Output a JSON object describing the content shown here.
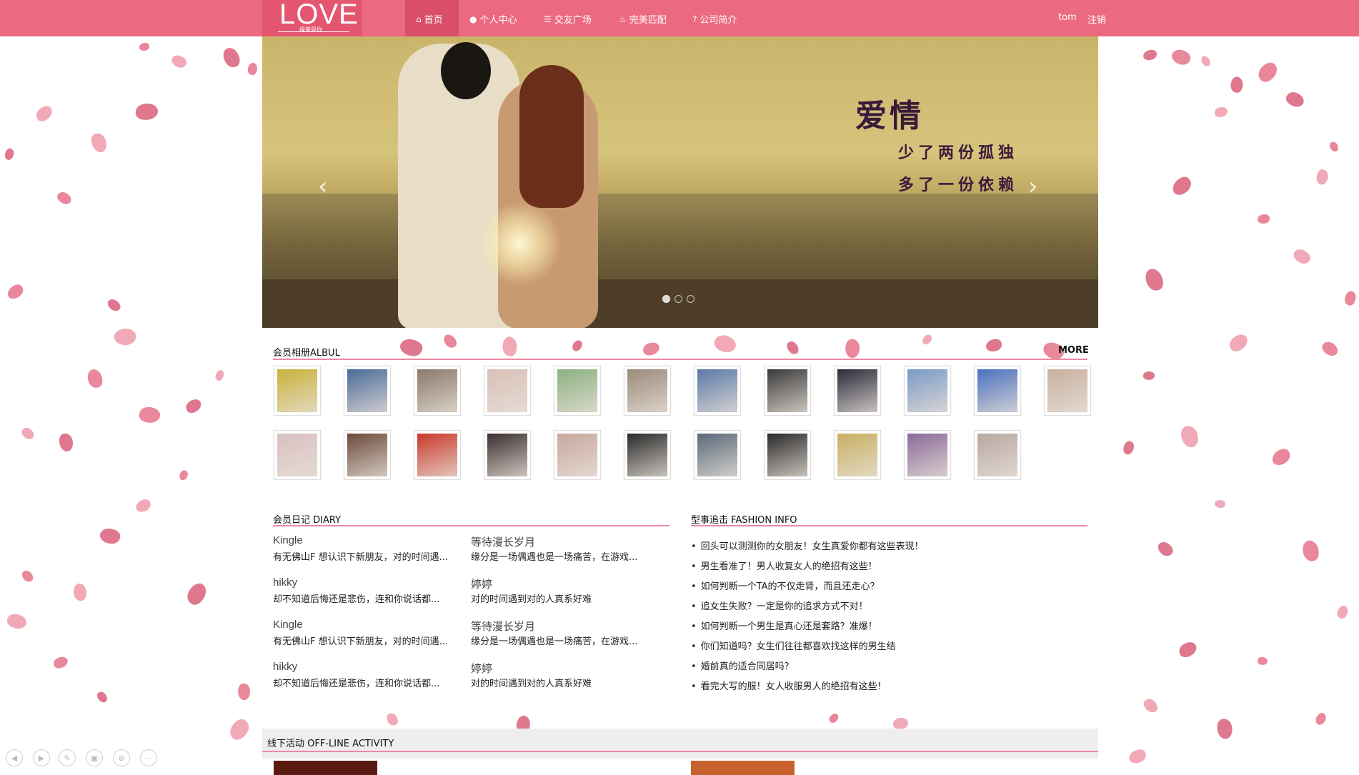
{
  "brand": {
    "logo": "LOVE",
    "tagline": "缘来是你"
  },
  "nav": {
    "items": [
      {
        "label": "首页",
        "icon": "home-icon"
      },
      {
        "label": "个人中心",
        "icon": "user-icon"
      },
      {
        "label": "交友广场",
        "icon": "list-icon"
      },
      {
        "label": "完美匹配",
        "icon": "fire-icon"
      },
      {
        "label": "公司简介",
        "icon": "question-icon"
      }
    ],
    "user": "tom",
    "logout": "注销"
  },
  "banner": {
    "caption_title": "爱情",
    "caption_line1": "少了两份孤独",
    "caption_line2": "多了一份依赖",
    "prev": "‹",
    "next": "›"
  },
  "album": {
    "title": "会员相册ALBUL",
    "more": "MORE"
  },
  "diary": {
    "title": "会员日记 DIARY",
    "entries": [
      {
        "name": "Kingle",
        "text": "有无佛山F 想认识下新朋友，对的时间遇..."
      },
      {
        "name": "等待漫长岁月",
        "text": "缘分是一场偶遇也是一场痛苦，在游戏..."
      },
      {
        "name": "hikky",
        "text": "却不知道后悔还是悲伤，连和你说话都..."
      },
      {
        "name": "婷婷",
        "text": "对的时间遇到对的人真系好难"
      },
      {
        "name": "Kingle",
        "text": "有无佛山F 想认识下新朋友，对的时间遇..."
      },
      {
        "name": "等待漫长岁月",
        "text": "缘分是一场偶遇也是一场痛苦，在游戏..."
      },
      {
        "name": "hikky",
        "text": "却不知道后悔还是悲伤，连和你说话都..."
      },
      {
        "name": "婷婷",
        "text": "对的时间遇到对的人真系好难"
      }
    ]
  },
  "fashion": {
    "title": "型事追击 FASHION INFO",
    "items": [
      "回头可以测测你的女朋友！女生真爱你都有这些表现！",
      "男生看准了！男人收复女人的绝招有这些！",
      "如何判断一个TA的不仅走肾，而且还走心？",
      "追女生失败？一定是你的追求方式不对！",
      "如何判断一个男生是真心还是套路？准爆！",
      "你们知道吗？女生们往往都喜欢找这样的男生结",
      "婚前真的适合同居吗？",
      "看完大写的服！女人收服男人的绝招有这些！"
    ]
  },
  "offline": {
    "title": "线下活动 OFF-LINE ACTIVITY"
  },
  "colors": {
    "nav": "#ec6a80",
    "accent_line": "#ec8aa0",
    "petal": "#e7788e"
  }
}
